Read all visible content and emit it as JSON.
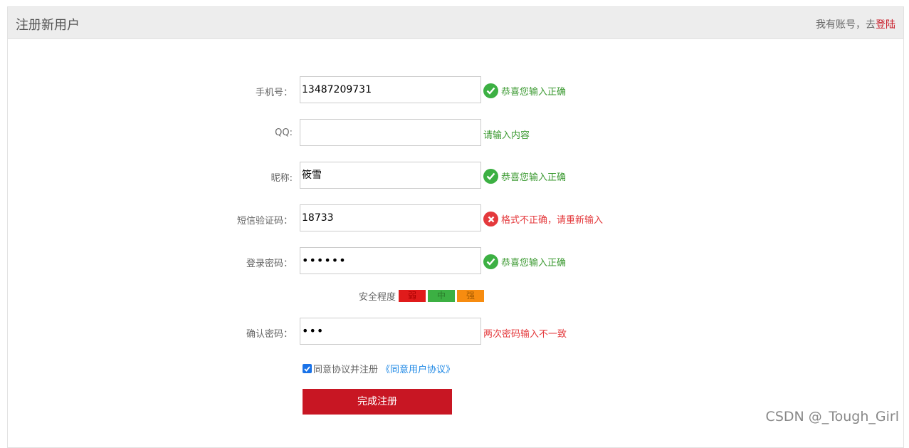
{
  "header": {
    "title": "注册新用户",
    "login_prompt": "我有账号，去",
    "login_link": "登陆"
  },
  "form": {
    "phone": {
      "label": "手机号：",
      "value": "13487209731",
      "status": "ok",
      "message": "恭喜您输入正确"
    },
    "qq": {
      "label": "QQ:",
      "value": "",
      "status": "tip",
      "message": "请输入内容"
    },
    "nickname": {
      "label": "昵称:",
      "value": "筱雪",
      "status": "ok",
      "message": "恭喜您输入正确"
    },
    "sms_code": {
      "label": "短信验证码：",
      "value": "18733",
      "status": "error",
      "message": "格式不正确，请重新输入"
    },
    "password": {
      "label": "登录密码：",
      "value": "••••••",
      "status": "ok",
      "message": "恭喜您输入正确"
    },
    "strength": {
      "label": "安全程度",
      "levels": [
        "弱",
        "中",
        "强"
      ]
    },
    "confirm_password": {
      "label": "确认密码：",
      "value": "•••",
      "status": "error",
      "message": "两次密码输入不一致"
    },
    "agreement": {
      "checked": true,
      "text": "同意协议并注册",
      "link": "《同意用户协议》"
    },
    "submit_label": "完成注册"
  },
  "colors": {
    "accent": "#c81623",
    "success": "#3cb043",
    "error": "#e4393c",
    "link": "#1e88e5"
  },
  "watermark": "CSDN @_Tough_Girl"
}
